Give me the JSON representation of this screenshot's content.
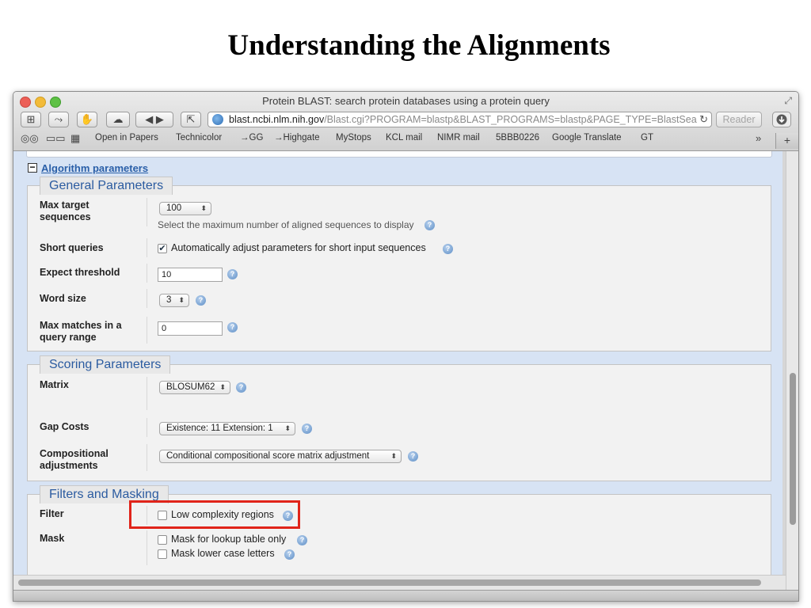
{
  "slide": {
    "title": "Understanding the Alignments"
  },
  "window": {
    "title": "Protein BLAST: search protein databases using a protein query",
    "url_domain": "blast.ncbi.nlm.nih.gov",
    "url_path": "/Blast.cgi?PROGRAM=blastp&BLAST_PROGRAMS=blastp&PAGE_TYPE=BlastSea",
    "reader_label": "Reader"
  },
  "bookmarks": [
    "Open in Papers",
    "Technicolor",
    "→GG",
    "→Highgate",
    "MyStops",
    "KCL mail",
    "NIMR mail",
    "5BBB0226",
    "Google Translate",
    "GT"
  ],
  "algorithm_link": "Algorithm parameters",
  "general": {
    "tab": "General Parameters",
    "max_target_label_1": "Max target",
    "max_target_label_2": "sequences",
    "max_target_value": "100",
    "max_target_hint": "Select the maximum number of aligned sequences to display",
    "short_queries_label": "Short queries",
    "short_queries_text": "Automatically adjust parameters for short input sequences",
    "expect_label": "Expect threshold",
    "expect_value": "10",
    "word_size_label": "Word size",
    "word_size_value": "3",
    "max_matches_label_1": "Max matches in a",
    "max_matches_label_2": "query range",
    "max_matches_value": "0"
  },
  "scoring": {
    "tab": "Scoring Parameters",
    "matrix_label": "Matrix",
    "matrix_value": "BLOSUM62",
    "gap_label": "Gap Costs",
    "gap_value": "Existence: 11 Extension: 1",
    "comp_label_1": "Compositional",
    "comp_label_2": "adjustments",
    "comp_value": "Conditional compositional score matrix adjustment"
  },
  "filters": {
    "tab": "Filters and Masking",
    "filter_label": "Filter",
    "low_complexity": "Low complexity regions",
    "mask_label": "Mask",
    "mask_lookup": "Mask for lookup table only",
    "mask_lower": "Mask lower case letters"
  },
  "colors": {
    "highlight": "#e0241a",
    "link": "#2a5fa8",
    "content_bg": "#d7e3f4"
  }
}
